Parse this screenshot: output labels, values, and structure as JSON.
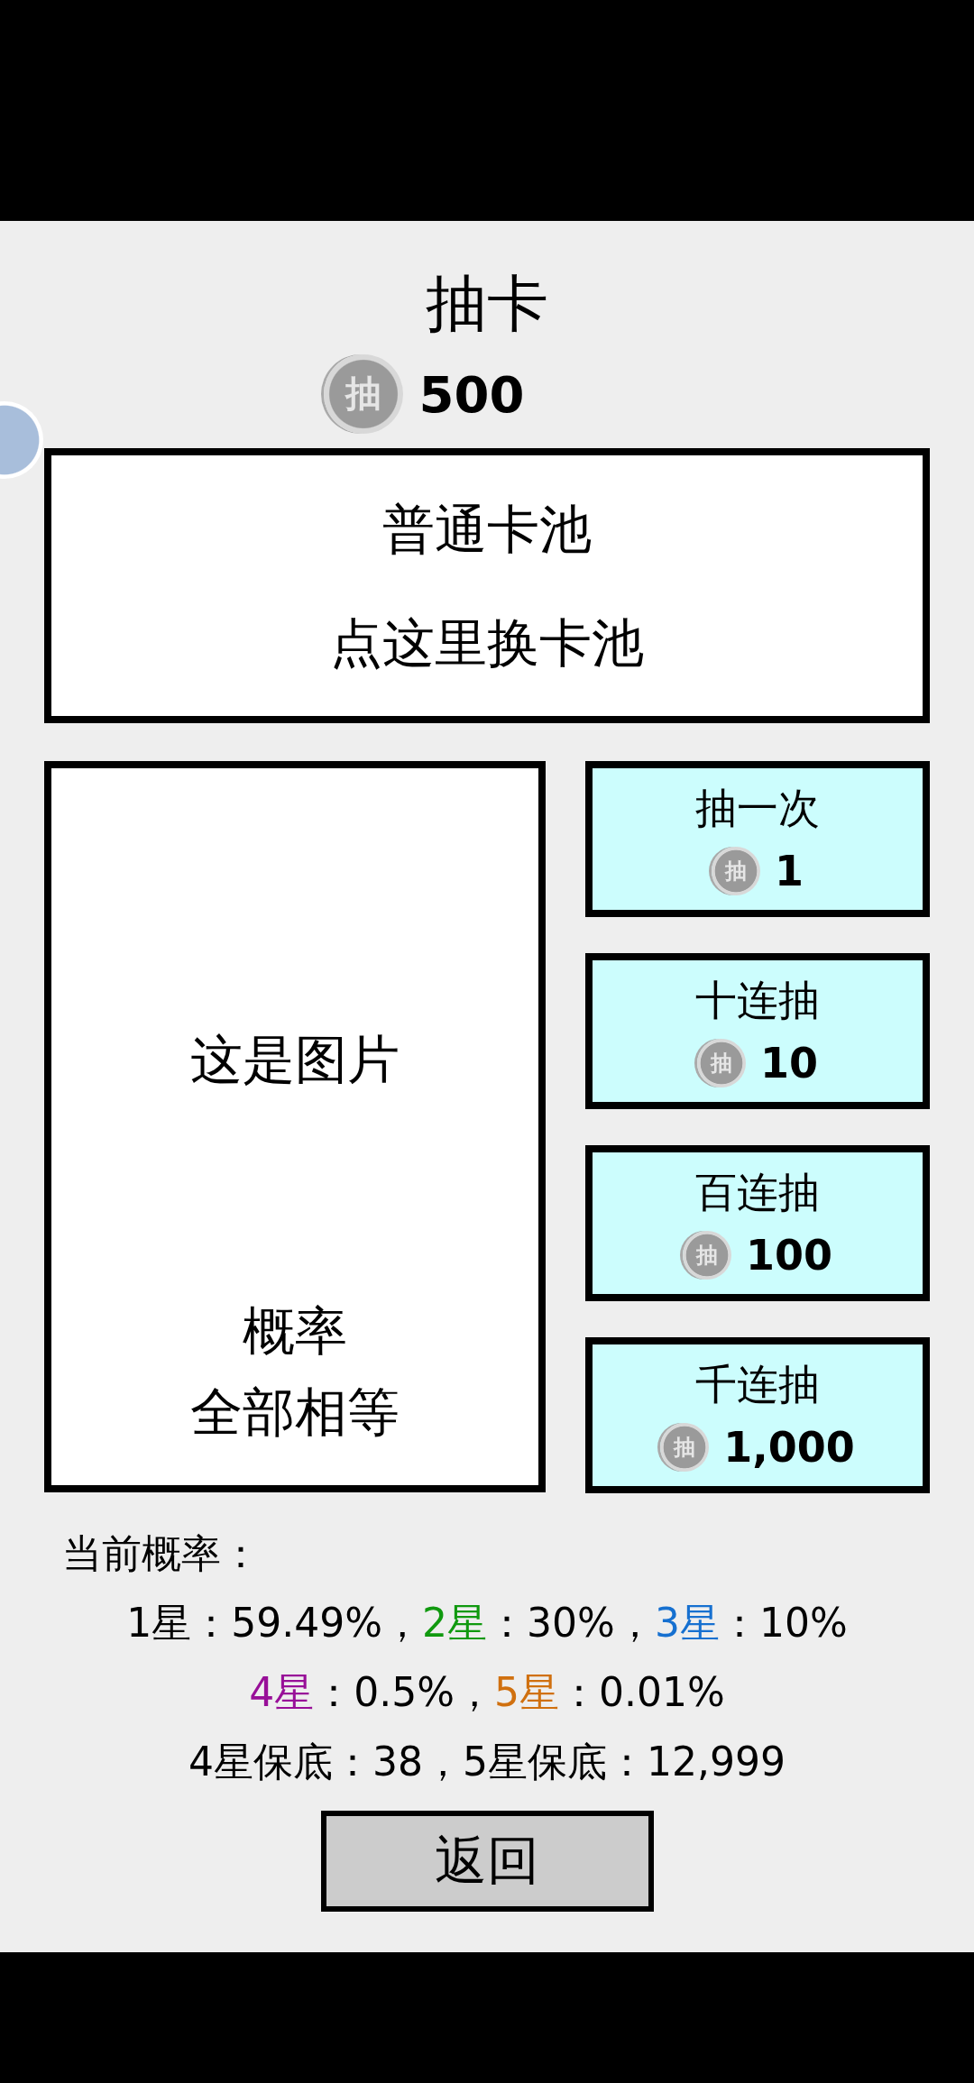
{
  "title": "抽卡",
  "balance": {
    "coin": "抽",
    "amount": "500"
  },
  "pool": {
    "name": "普通卡池",
    "hint": "点这里换卡池"
  },
  "image_panel": {
    "placeholder": "这是图片",
    "note_lines": [
      "概率",
      "全部相等"
    ]
  },
  "draw_buttons": [
    {
      "label": "抽一次",
      "coin": "抽",
      "cost": "1"
    },
    {
      "label": "十连抽",
      "coin": "抽",
      "cost": "10"
    },
    {
      "label": "百连抽",
      "coin": "抽",
      "cost": "100"
    },
    {
      "label": "千连抽",
      "coin": "抽",
      "cost": "1,000"
    }
  ],
  "rates": {
    "heading": "当前概率：",
    "lines": [
      [
        {
          "text": "1星",
          "color": "#000000"
        },
        {
          "text": "：59.49%，"
        },
        {
          "text": "2星",
          "color": "#10990f"
        },
        {
          "text": "：30%，"
        },
        {
          "text": "3星",
          "color": "#1670d0"
        },
        {
          "text": "：10%"
        }
      ],
      [
        {
          "text": "4星",
          "color": "#980f98"
        },
        {
          "text": "：0.5%，"
        },
        {
          "text": "5星",
          "color": "#d0700f"
        },
        {
          "text": "：0.01%"
        }
      ],
      [
        {
          "text": "4星保底：38，5星保底：12,999"
        }
      ]
    ]
  },
  "back_button": "返回"
}
